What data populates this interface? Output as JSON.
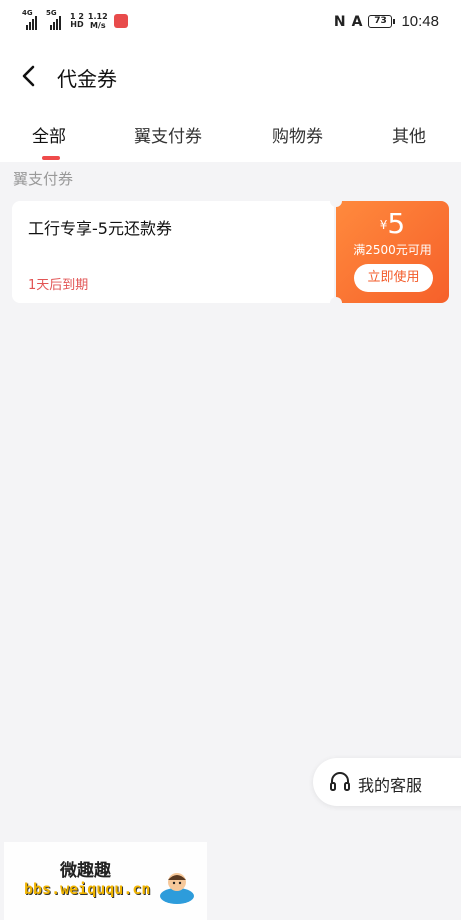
{
  "status_bar": {
    "signal1_tag": "4G",
    "signal2_tag": "5G",
    "hd_top": "1 2",
    "hd_bottom": "HD",
    "speed_value": "1.12",
    "speed_unit": "M/s",
    "battery_level": "73",
    "time": "10:48"
  },
  "header": {
    "title": "代金券"
  },
  "tabs": [
    {
      "label": "全部",
      "active": true
    },
    {
      "label": "翼支付券",
      "active": false
    },
    {
      "label": "购物券",
      "active": false
    },
    {
      "label": "其他",
      "active": false
    }
  ],
  "section": {
    "label": "翼支付券"
  },
  "coupon": {
    "name": "工行专享-5元还款券",
    "expiry": "1天后到期",
    "currency": "¥",
    "amount": "5",
    "condition": "满2500元可用",
    "button": "立即使用"
  },
  "service": {
    "label": "我的客服"
  },
  "watermark": {
    "title": "微趣趣",
    "url": "bbs.weiququ.cn"
  },
  "colors": {
    "accent": "#ef4b4b",
    "coupon_gradient_start": "#ff8a3d",
    "coupon_gradient_end": "#f6602a",
    "background": "#f4f4f6"
  }
}
